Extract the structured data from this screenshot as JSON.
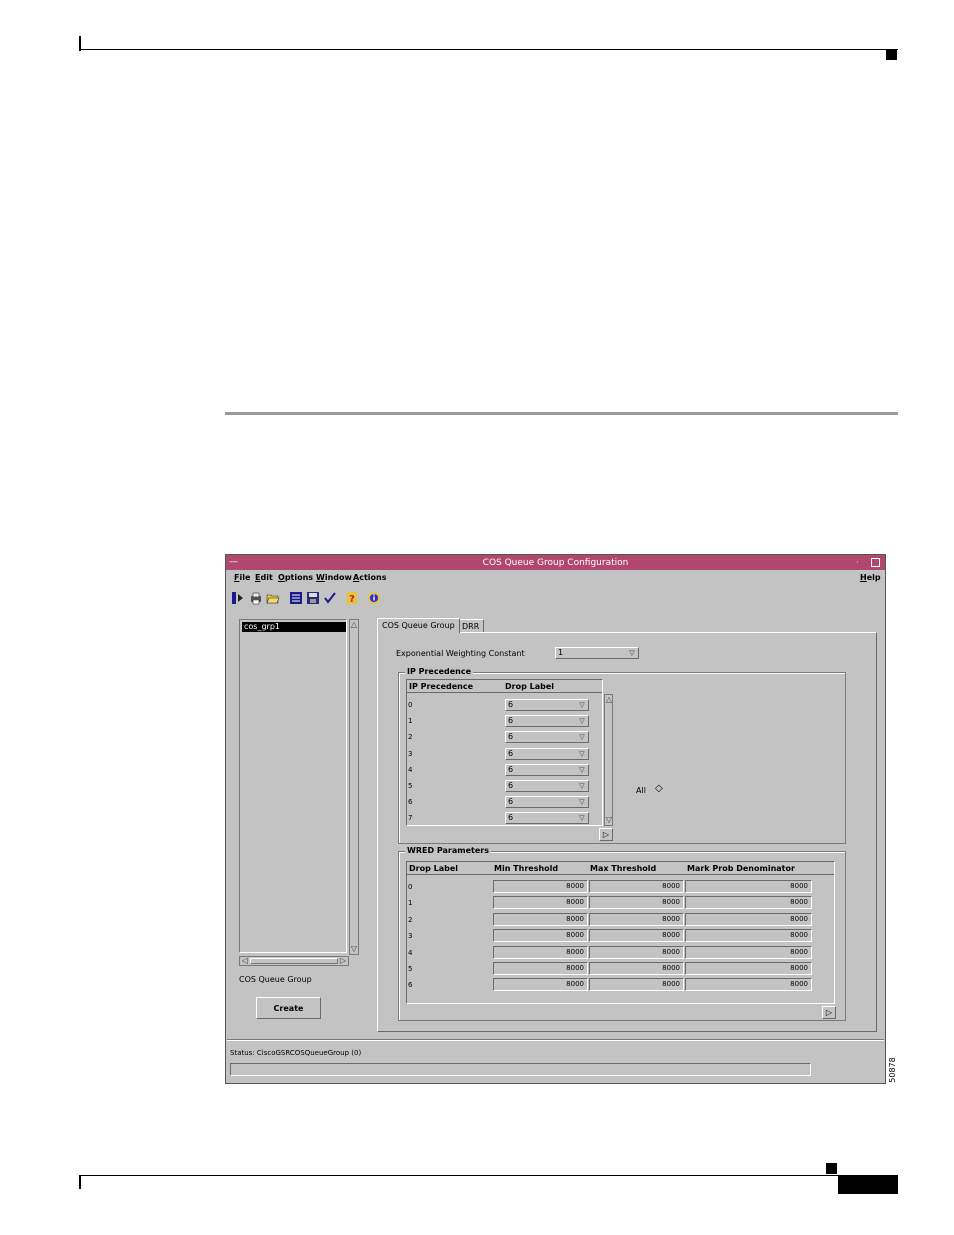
{
  "figure_number": "50878",
  "window": {
    "title": "COS Queue Group Configuration",
    "menus": [
      {
        "label": "File",
        "underline": "F",
        "rest": "ile"
      },
      {
        "label": "Edit",
        "underline": "E",
        "rest": "dit"
      },
      {
        "label": "Options",
        "underline": "O",
        "rest": "ptions"
      },
      {
        "label": "Window",
        "underline": "W",
        "rest": "indow"
      },
      {
        "label": "Actions",
        "underline": "A",
        "rest": "ctions"
      }
    ],
    "help_menu": {
      "underline": "H",
      "rest": "elp"
    },
    "toolbar_icons": [
      "exit-icon",
      "print-icon",
      "open-icon",
      "list-icon",
      "save-icon",
      "check-icon",
      "help-icon",
      "info-icon"
    ],
    "list": {
      "items": [
        "cos_grp1"
      ],
      "caption": "COS Queue Group",
      "create_label": "Create"
    },
    "tabs": [
      "COS Queue Group",
      "DRR"
    ],
    "ewc": {
      "label": "Exponential Weighting Constant",
      "value": "1"
    },
    "ip_precedence": {
      "group_title": "IP Precedence",
      "col_precedence": "IP Precedence",
      "col_drop": "Drop Label",
      "rows": [
        {
          "precedence": "0",
          "drop": "6"
        },
        {
          "precedence": "1",
          "drop": "6"
        },
        {
          "precedence": "2",
          "drop": "6"
        },
        {
          "precedence": "3",
          "drop": "6"
        },
        {
          "precedence": "4",
          "drop": "6"
        },
        {
          "precedence": "5",
          "drop": "6"
        },
        {
          "precedence": "6",
          "drop": "6"
        },
        {
          "precedence": "7",
          "drop": "6"
        }
      ],
      "all_label": "All"
    },
    "wred": {
      "group_title": "WRED Parameters",
      "col_drop": "Drop Label",
      "col_min": "Min Threshold",
      "col_max": "Max Threshold",
      "col_mark": "Mark Prob Denominator",
      "rows": [
        {
          "drop": "0",
          "min": "8000",
          "max": "8000",
          "mark": "8000"
        },
        {
          "drop": "1",
          "min": "8000",
          "max": "8000",
          "mark": "8000"
        },
        {
          "drop": "2",
          "min": "8000",
          "max": "8000",
          "mark": "8000"
        },
        {
          "drop": "3",
          "min": "8000",
          "max": "8000",
          "mark": "8000"
        },
        {
          "drop": "4",
          "min": "8000",
          "max": "8000",
          "mark": "8000"
        },
        {
          "drop": "5",
          "min": "8000",
          "max": "8000",
          "mark": "8000"
        },
        {
          "drop": "6",
          "min": "8000",
          "max": "8000",
          "mark": "8000"
        }
      ]
    },
    "status": "Status: CiscoGSRCOSQueueGroup (0)"
  }
}
